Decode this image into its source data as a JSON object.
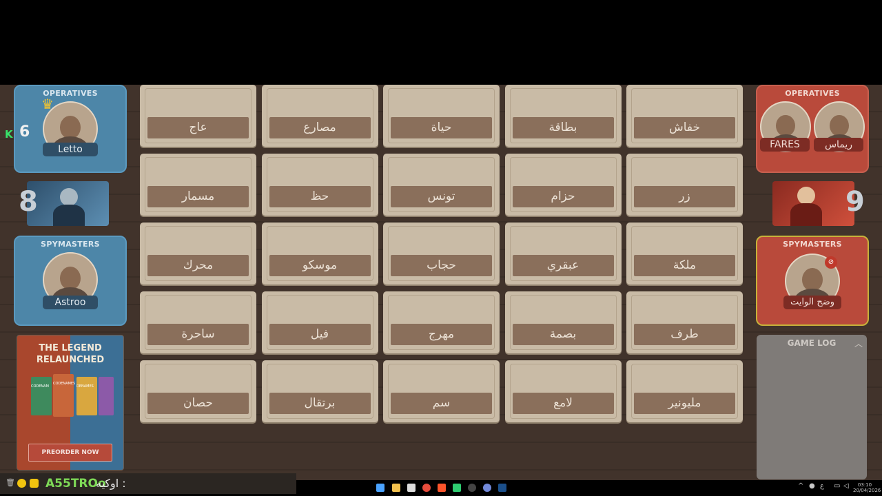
{
  "blue_team": {
    "operatives_title": "OPERATIVES",
    "operative_name": "Letto",
    "score": "6",
    "spymasters_title": "SPYMASTERS",
    "spymaster_name": "Astroo",
    "remaining": "8"
  },
  "red_team": {
    "operatives_title": "OPERATIVES",
    "operatives": [
      "FARES",
      "ريماس"
    ],
    "remaining": "9",
    "spymasters_title": "SPYMASTERS",
    "spymaster_name": "وضح الوايت"
  },
  "board": {
    "cards": [
      "عاج",
      "مصارع",
      "حياة",
      "بطاقة",
      "خفاش",
      "مسمار",
      "حظ",
      "تونس",
      "حزام",
      "زر",
      "محرك",
      "موسكو",
      "حجاب",
      "عبقري",
      "ملكة",
      "ساحرة",
      "فيل",
      "مهرج",
      "بصمة",
      "طرف",
      "حصان",
      "برتقال",
      "سم",
      "لامع",
      "مليونير"
    ]
  },
  "ad": {
    "headline": "THE LEGEND RELAUNCHED",
    "button_label": "PREORDER NOW",
    "box_titles": [
      "CODENAM",
      "CODENAMES",
      "DENAMES"
    ]
  },
  "game_log": {
    "title": "GAME LOG"
  },
  "chat": {
    "kick_icon": "K",
    "username": "A55TROo",
    "message": "اوكيه :"
  },
  "taskbar": {
    "time": "03:10",
    "date": "20/04/2026",
    "lang": "ع"
  },
  "colors": {
    "blue": "#4d86a8",
    "red": "#b94a3b",
    "card": "#c9bba6",
    "word_bar": "#8a6f5b"
  }
}
